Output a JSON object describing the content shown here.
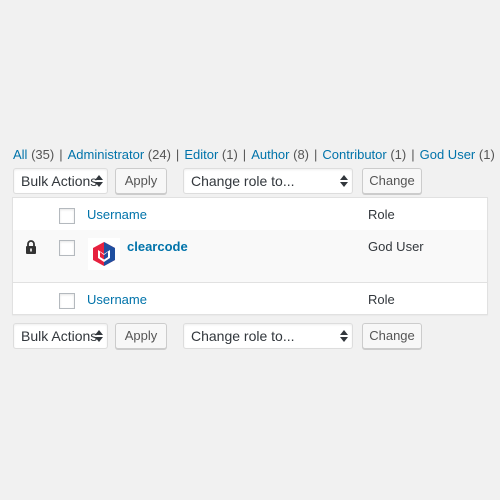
{
  "filters": [
    {
      "label": "All",
      "count": "(35)"
    },
    {
      "label": "Administrator",
      "count": "(24)"
    },
    {
      "label": "Editor",
      "count": "(1)"
    },
    {
      "label": "Author",
      "count": "(8)"
    },
    {
      "label": "Contributor",
      "count": "(1)"
    },
    {
      "label": "God User",
      "count": "(1)"
    }
  ],
  "separator": "|",
  "tablenav_top": {
    "bulk_label": "Bulk Actions",
    "apply_label": "Apply",
    "role_label": "Change role to...",
    "change_label": "Change"
  },
  "tablenav_bottom": {
    "bulk_label": "Bulk Actions",
    "apply_label": "Apply",
    "role_label": "Change role to...",
    "change_label": "Change"
  },
  "table": {
    "header": {
      "username": "Username",
      "role": "Role"
    },
    "footer": {
      "username": "Username",
      "role": "Role"
    },
    "rows": [
      {
        "username": "clearcode",
        "role": "God User",
        "locked": true,
        "avatar_icon": "clearcode-logo-icon"
      }
    ]
  },
  "colors": {
    "link": "#0073aa",
    "background": "#f1f1f1",
    "logo_red": "#e6213f",
    "logo_blue": "#1f4fa0"
  }
}
